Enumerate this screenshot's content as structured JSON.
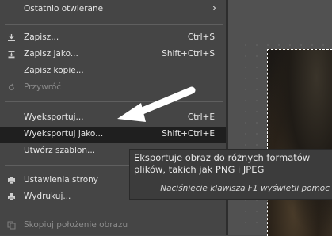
{
  "menu": {
    "recent": {
      "label": "Ostatnio otwierane"
    },
    "save": {
      "label": "Zapisz...",
      "accel": "Ctrl+S"
    },
    "save_as": {
      "label": "Zapisz jako...",
      "accel": "Shift+Ctrl+S"
    },
    "save_copy": {
      "label": "Zapisz kopię..."
    },
    "revert": {
      "label": "Przywróć"
    },
    "export": {
      "label": "Wyeksportuj...",
      "accel": "Ctrl+E"
    },
    "export_as": {
      "label": "Wyeksportuj jako...",
      "accel": "Shift+Ctrl+E"
    },
    "template": {
      "label": "Utwórz szablon..."
    },
    "page_setup": {
      "label": "Ustawienia strony"
    },
    "print": {
      "label": "Wydrukuj..."
    },
    "copy_location": {
      "label": "Skopiuj położenie obrazu"
    }
  },
  "tooltip": {
    "line1": "Eksportuje obraz do różnych formatów",
    "line2": "plików, takich jak PNG i JPEG",
    "hint": "Naciśnięcie klawisza F1 wyświetli pomoc"
  },
  "colors": {
    "menu_bg": "#454545",
    "highlight_bg": "#1f1f1f",
    "tooltip_bg": "#3c3c3c",
    "arrow": "#ffffff"
  }
}
